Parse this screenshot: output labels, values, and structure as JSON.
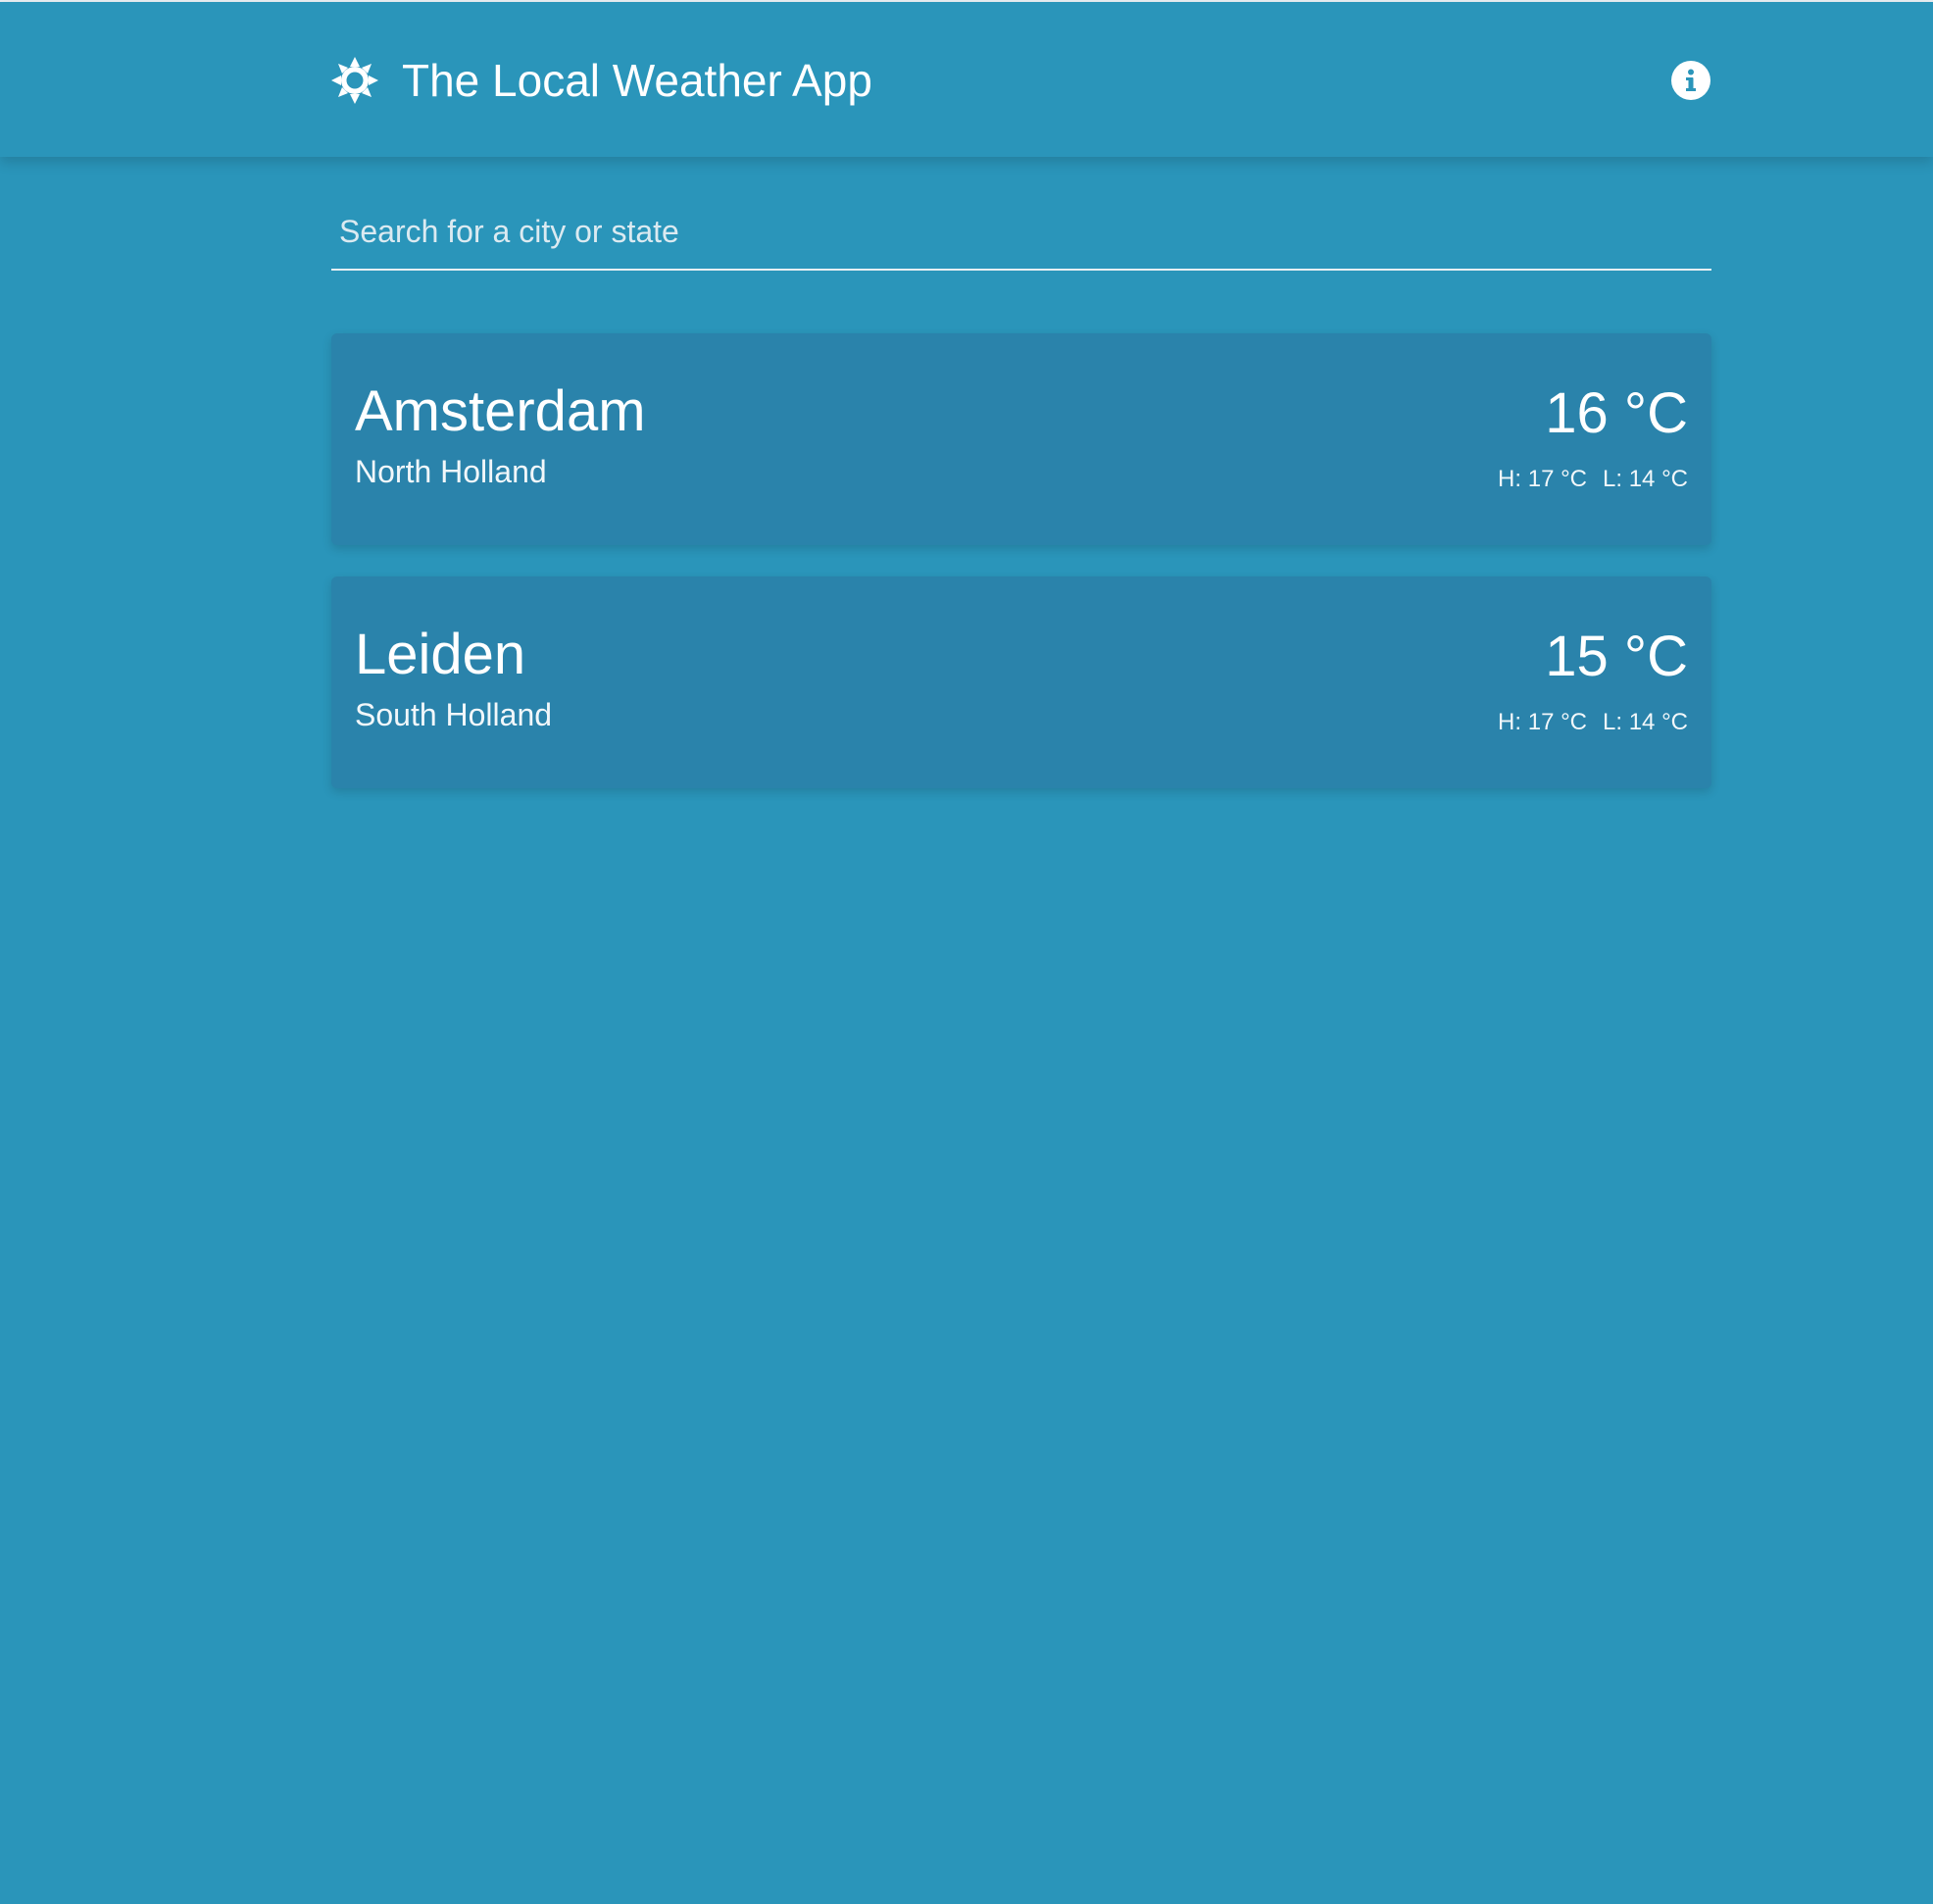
{
  "header": {
    "title": "The Local Weather App",
    "logo_icon": "sun-icon",
    "info_icon": "info-icon"
  },
  "search": {
    "placeholder": "Search for a city or state",
    "value": ""
  },
  "cities": [
    {
      "name": "Amsterdam",
      "region": "North Holland",
      "temperature": "16 °C",
      "high": "H: 17 °C",
      "low": "L: 14 °C"
    },
    {
      "name": "Leiden",
      "region": "South Holland",
      "temperature": "15 °C",
      "high": "H: 17 °C",
      "low": "L: 14 °C"
    }
  ],
  "colors": {
    "background": "#2a95ba",
    "card": "#2a83ab",
    "text": "#ffffff"
  }
}
